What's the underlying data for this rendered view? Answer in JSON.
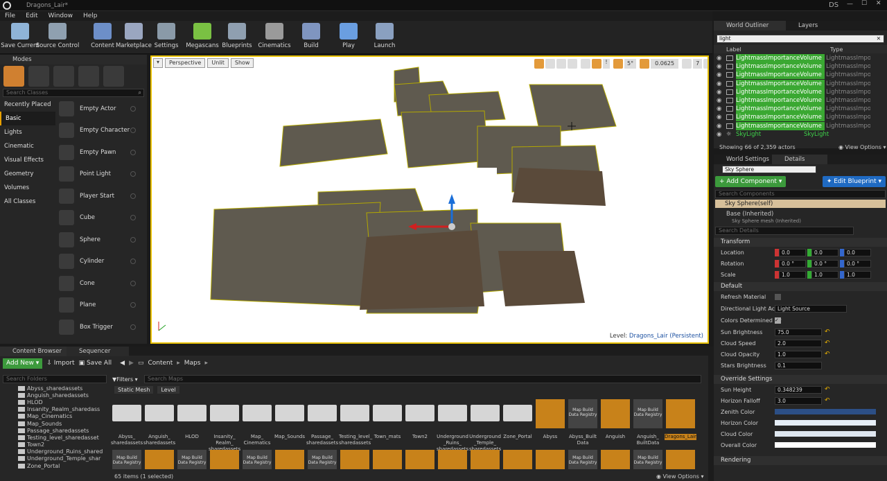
{
  "window": {
    "title": "Dragons_Lair*",
    "user": "DS"
  },
  "menu": [
    "File",
    "Edit",
    "Window",
    "Help"
  ],
  "toolbar": [
    {
      "label": "Save Current",
      "icon": "save-icon",
      "color": "#8fb4d8"
    },
    {
      "label": "Source Control",
      "icon": "source-control-icon",
      "color": "#8fa0b0"
    },
    {
      "label": "Content",
      "icon": "content-icon",
      "color": "#6d8fc8"
    },
    {
      "label": "Marketplace",
      "icon": "marketplace-icon",
      "color": "#9aa6c0"
    },
    {
      "label": "Settings",
      "icon": "settings-gear-icon",
      "color": "#8a9aa8"
    },
    {
      "label": "Megascans",
      "icon": "megascans-icon",
      "color": "#7ac143"
    },
    {
      "label": "Blueprints",
      "icon": "blueprints-icon",
      "color": "#8f9fb0"
    },
    {
      "label": "Cinematics",
      "icon": "cinematics-icon",
      "color": "#9a9a9a"
    },
    {
      "label": "Build",
      "icon": "build-icon",
      "color": "#7f95c0"
    },
    {
      "label": "Play",
      "icon": "play-icon",
      "color": "#6a9ee0"
    },
    {
      "label": "Launch",
      "icon": "launch-icon",
      "color": "#8aa0c0"
    }
  ],
  "modes": {
    "title": "Modes",
    "search_placeholder": "Search Classes",
    "categories": [
      "Recently Placed",
      "Basic",
      "Lights",
      "Cinematic",
      "Visual Effects",
      "Geometry",
      "Volumes",
      "All Classes"
    ],
    "items": [
      "Empty Actor",
      "Empty Character",
      "Empty Pawn",
      "Point Light",
      "Player Start",
      "Cube",
      "Sphere",
      "Cylinder",
      "Cone",
      "Plane",
      "Box Trigger"
    ]
  },
  "viewport": {
    "perspective": "Perspective",
    "unlit": "Unlit",
    "show": "Show",
    "angle": "5°",
    "scale": "0.0625",
    "speed": "7",
    "level_label": "Level:",
    "level_name": "Dragons_Lair (Persistent)"
  },
  "outliner": {
    "tabs": [
      "World Outliner",
      "Layers"
    ],
    "search": "light",
    "col_label": "Label",
    "col_type": "Type",
    "rows": [
      "LightmassImportanceVolume",
      "LightmassImportanceVolume",
      "LightmassImportanceVolume",
      "LightmassImportanceVolume",
      "LightmassImportanceVolume",
      "LightmassImportanceVolume",
      "LightmassImportanceVolume",
      "LightmassImportanceVolume",
      "LightmassImportanceVolume"
    ],
    "last_row": "SkyLight",
    "last_type": "SkyLight",
    "status": "Showing 66 of 2,359 actors",
    "view_options": "View Options"
  },
  "details": {
    "tabs": [
      "World Settings",
      "Details"
    ],
    "actor": "Sky Sphere",
    "add_component": "+ Add Component",
    "edit_blueprint": "Edit Blueprint",
    "search_components": "Search Components",
    "self": "Sky Sphere(self)",
    "base": "Base (Inherited)",
    "mesh": "Sky Sphere mesh (Inherited)",
    "search_details": "Search Details",
    "transform": "Transform",
    "location": {
      "label": "Location",
      "x": "0.0",
      "y": "0.0",
      "z": "0.0"
    },
    "rotation": {
      "label": "Rotation",
      "x": "0.0 °",
      "y": "0.0 °",
      "z": "0.0 °"
    },
    "scale": {
      "label": "Scale",
      "x": "1.0",
      "y": "1.0",
      "z": "1.0"
    },
    "default": "Default",
    "refresh_material": "Refresh Material",
    "dir_light": "Directional Light Actor",
    "dir_light_value": "Light Source",
    "colors_determined": "Colors Determined By",
    "sun_brightness": {
      "label": "Sun Brightness",
      "value": "75.0"
    },
    "cloud_speed": {
      "label": "Cloud Speed",
      "value": "2.0"
    },
    "cloud_opacity": {
      "label": "Cloud Opacity",
      "value": "1.0"
    },
    "stars_brightness": {
      "label": "Stars Brightness",
      "value": "0.1"
    },
    "override": "Override Settings",
    "sun_height": {
      "label": "Sun Height",
      "value": "0.348239"
    },
    "horizon_falloff": {
      "label": "Horizon Falloff",
      "value": "3.0"
    },
    "zenith": "Zenith Color",
    "horizon": "Horizon Color",
    "cloud_color": "Cloud Color",
    "overall": "Overall Color",
    "rendering": "Rendering",
    "colors": {
      "zenith": "#2c4f86",
      "horizon": "#e6eef7",
      "cloud": "#dfe7f0",
      "overall": "#ffffff"
    }
  },
  "content": {
    "tabs": [
      "Content Browser",
      "Sequencer"
    ],
    "add_new": "Add New",
    "import": "Import",
    "save_all": "Save All",
    "path": [
      "Content",
      "Maps"
    ],
    "search_folders": "Search Folders",
    "filters": "Filters",
    "search_maps": "Search Maps",
    "filter_chips": [
      "Static Mesh",
      "Level"
    ],
    "folders": [
      "Abyss_sharedassets",
      "Anguish_sharedassets",
      "HLOD",
      "Insanity_Realm_sharedass",
      "Map_Cinematics",
      "Map_Sounds",
      "Passage_sharedassets",
      "Testing_level_sharedasset",
      "Town2",
      "Underground_Ruins_shared",
      "Underground_Temple_shar",
      "Zone_Portal"
    ],
    "assets": [
      {
        "label": "Abyss_ sharedassets",
        "kind": "folder"
      },
      {
        "label": "Anguish_ sharedassets",
        "kind": "folder"
      },
      {
        "label": "HLOD",
        "kind": "folder"
      },
      {
        "label": "Insanity_ Realm_ sharedassets",
        "kind": "folder"
      },
      {
        "label": "Map_ Cinematics",
        "kind": "folder"
      },
      {
        "label": "Map_Sounds",
        "kind": "folder"
      },
      {
        "label": "Passage_ sharedassets",
        "kind": "folder"
      },
      {
        "label": "Testing_level_ sharedassets",
        "kind": "folder"
      },
      {
        "label": "Town_mats",
        "kind": "folder"
      },
      {
        "label": "Town2",
        "kind": "folder"
      },
      {
        "label": "Underground _Ruins_ sharedassets",
        "kind": "folder"
      },
      {
        "label": "Underground _Temple_ sharedassets",
        "kind": "folder"
      },
      {
        "label": "Zone_Portal",
        "kind": "folder"
      },
      {
        "label": "Abyss",
        "kind": "map"
      },
      {
        "label": "Abyss_Built Data",
        "kind": "registry"
      },
      {
        "label": "Anguish",
        "kind": "map"
      },
      {
        "label": "Anguish_ BuiltData",
        "kind": "registry"
      },
      {
        "label": "Dragons_Lair",
        "kind": "map"
      }
    ],
    "registry_label": "Map Build Data Registry",
    "status": "65 items (1 selected)",
    "view_options": "View Options"
  }
}
